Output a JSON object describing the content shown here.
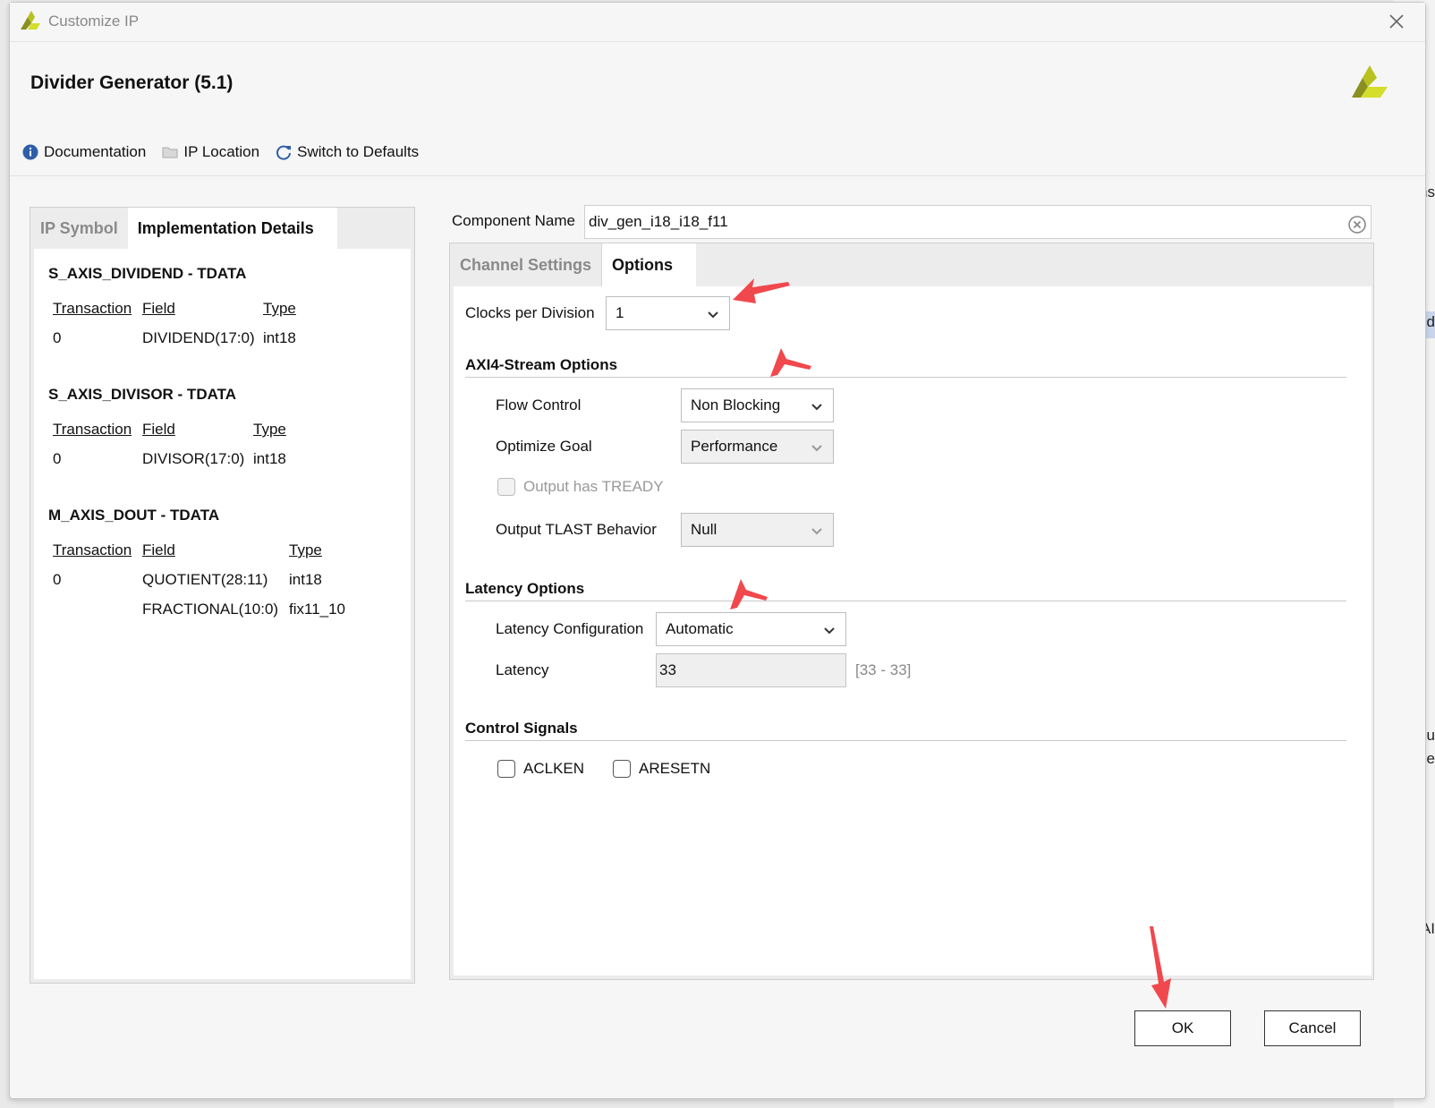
{
  "window": {
    "title": "Customize IP"
  },
  "header": {
    "title": "Divider Generator (5.1)"
  },
  "toolbar": {
    "documentation": "Documentation",
    "ip_location": "IP Location",
    "switch_to_defaults": "Switch to Defaults"
  },
  "left_panel": {
    "tabs": [
      "IP Symbol",
      "Implementation Details"
    ],
    "active_tab": "Implementation Details",
    "sections": [
      {
        "title": "S_AXIS_DIVIDEND - TDATA",
        "headers": [
          "Transaction",
          "Field",
          "Type"
        ],
        "rows": [
          [
            "0",
            "DIVIDEND(17:0)",
            "int18"
          ]
        ]
      },
      {
        "title": "S_AXIS_DIVISOR - TDATA",
        "headers": [
          "Transaction",
          "Field",
          "Type"
        ],
        "rows": [
          [
            "0",
            "DIVISOR(17:0)",
            "int18"
          ]
        ]
      },
      {
        "title": "M_AXIS_DOUT - TDATA",
        "headers": [
          "Transaction",
          "Field",
          "Type"
        ],
        "rows": [
          [
            "0",
            "QUOTIENT(28:11)",
            "int18"
          ],
          [
            "",
            "FRACTIONAL(10:0)",
            "fix11_10"
          ]
        ]
      }
    ]
  },
  "component": {
    "label": "Component Name",
    "value": "div_gen_i18_i18_f11"
  },
  "right_panel": {
    "tabs": [
      "Channel Settings",
      "Options"
    ],
    "active_tab": "Options",
    "clocks_per_division": {
      "label": "Clocks per Division",
      "value": "1"
    },
    "axi4_stream": {
      "title": "AXI4-Stream Options",
      "flow_control": {
        "label": "Flow Control",
        "value": "Non Blocking"
      },
      "optimize_goal": {
        "label": "Optimize Goal",
        "value": "Performance"
      },
      "output_tready": {
        "label": "Output has TREADY",
        "checked": false,
        "enabled": false
      },
      "output_tlast": {
        "label": "Output TLAST Behavior",
        "value": "Null"
      }
    },
    "latency": {
      "title": "Latency Options",
      "configuration": {
        "label": "Latency Configuration",
        "value": "Automatic"
      },
      "latency": {
        "label": "Latency",
        "value": "33",
        "range": "[33 - 33]"
      }
    },
    "control_signals": {
      "title": "Control Signals",
      "aclken": {
        "label": "ACLKEN",
        "checked": false
      },
      "aresetn": {
        "label": "ARESETN",
        "checked": false
      }
    }
  },
  "buttons": {
    "ok": "OK",
    "cancel": "Cancel"
  },
  "background_fragments": [
    "ns",
    "d",
    "u",
    "de",
    "AI"
  ],
  "colors": {
    "annotation_arrow": "#f0484d",
    "xilinx_logo_dark": "#8a8f1f",
    "xilinx_logo_light": "#d4de2b",
    "info_icon": "#2f5ea8"
  }
}
